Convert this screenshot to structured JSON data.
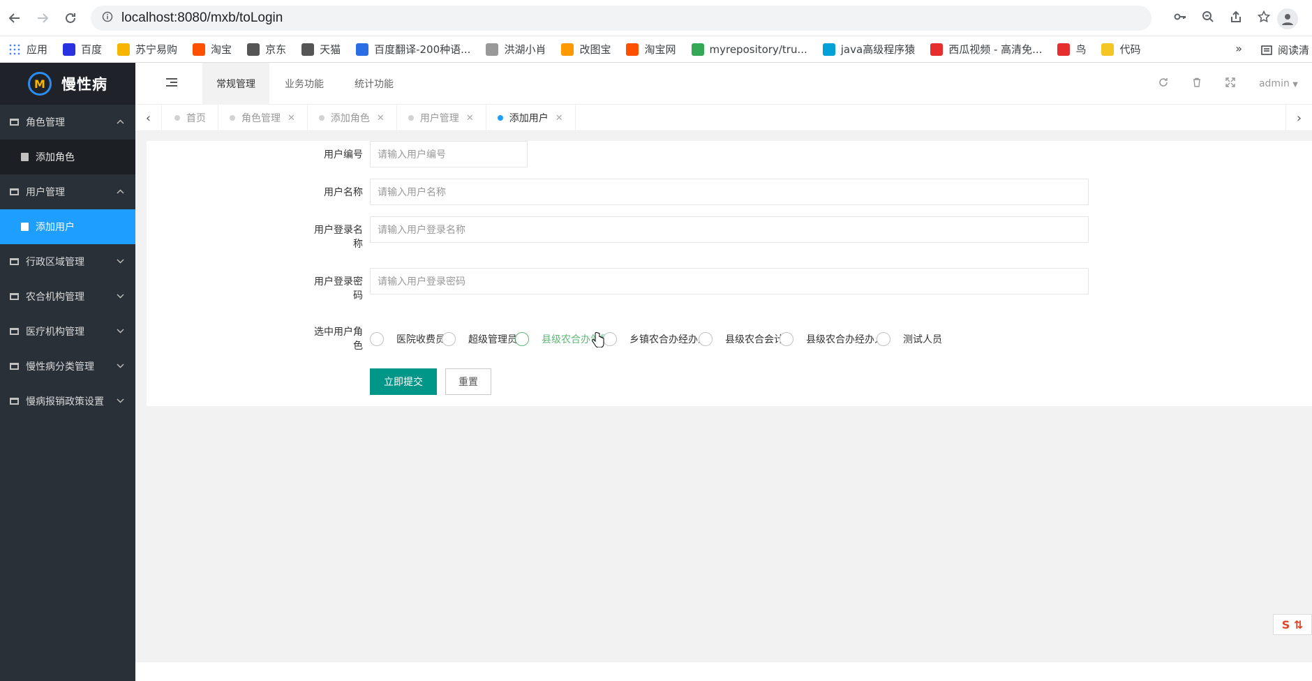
{
  "browser": {
    "url": "localhost:8080/mxb/toLogin",
    "bookmarks": [
      "应用",
      "百度",
      "苏宁易购",
      "淘宝",
      "京东",
      "天猫",
      "百度翻译-200种语...",
      "洪湖小肖",
      "改图宝",
      "淘宝网",
      "myrepository/tru...",
      "java高级程序猿",
      "西瓜视频 - 高清免...",
      "鸟",
      "代码"
    ],
    "bookmark_colors": [
      "#4285f4",
      "#2932e1",
      "#f7b500",
      "#ff5000",
      "#555555",
      "#555555",
      "#2b6de5",
      "#999999",
      "#ff9900",
      "#ff5000",
      "#34a853",
      "#00a1d6",
      "#e62e2e",
      "#e62e2e",
      "#f3c623"
    ],
    "more": "»",
    "reader_mode": "阅读清"
  },
  "app": {
    "logo_text": "慢性病"
  },
  "sidebar": {
    "items": [
      {
        "label": "角色管理",
        "expanded": true,
        "children": [
          "添加角色"
        ]
      },
      {
        "label": "用户管理",
        "expanded": true,
        "children": [
          "添加用户"
        ]
      },
      {
        "label": "行政区域管理",
        "expanded": false
      },
      {
        "label": "农合机构管理",
        "expanded": false
      },
      {
        "label": "医疗机构管理",
        "expanded": false
      },
      {
        "label": "慢性病分类管理",
        "expanded": false
      },
      {
        "label": "慢病报销政策设置",
        "expanded": false
      }
    ],
    "active_child": "添加用户"
  },
  "header": {
    "tabs": [
      "常规管理",
      "业务功能",
      "统计功能"
    ],
    "active_tab": "常规管理",
    "user": "admin"
  },
  "tabstrip": {
    "tabs": [
      "首页",
      "角色管理",
      "添加角色",
      "用户管理",
      "添加用户"
    ],
    "active": "添加用户"
  },
  "form": {
    "user_no_label": "用户编号",
    "user_no_placeholder": "请输入用户编号",
    "user_name_label": "用户名称",
    "user_name_placeholder": "请输入用户名称",
    "login_name_label_1": "用户登录名",
    "login_name_label_2": "称",
    "login_name_placeholder": "请输入用户登录名称",
    "login_pwd_label_1": "用户登录密",
    "login_pwd_label_2": "码",
    "login_pwd_placeholder": "请输入用户登录密码",
    "role_label_1": "选中用户角",
    "role_label_2": "色",
    "roles": [
      "医院收费员",
      "超级管理员",
      "县级农合办领导",
      "乡镇农合办经办人",
      "县级农合会计",
      "县级农合办经办人",
      "测试人员"
    ],
    "hovered_role": "县级农合办领导",
    "submit": "立即提交",
    "reset": "重置"
  },
  "colors": {
    "sidebar_bg": "#293038",
    "active_blue": "#1e9fff",
    "submit_green": "#009688",
    "hover_green": "#5fb878"
  }
}
